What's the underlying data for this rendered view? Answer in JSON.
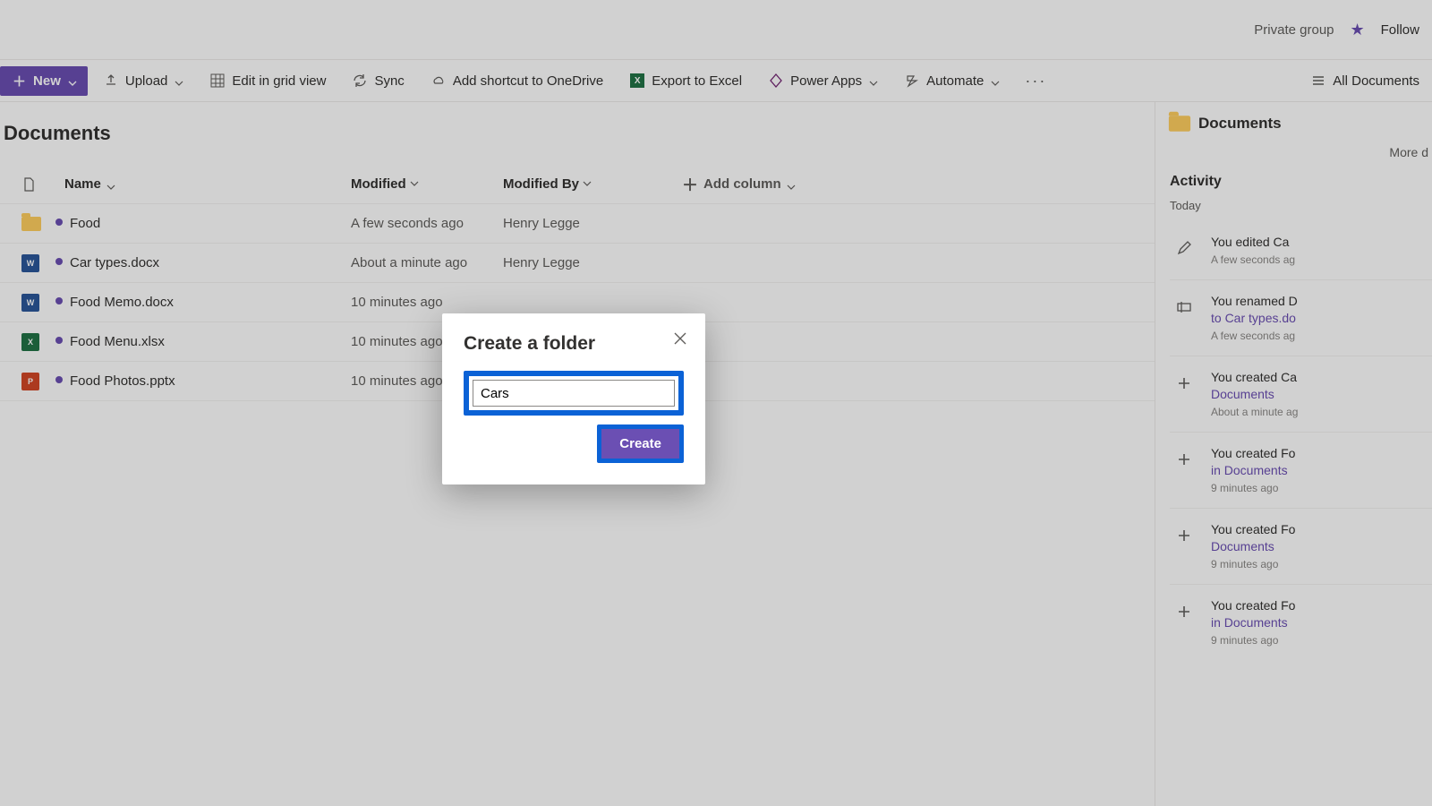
{
  "topbar": {
    "private": "Private group",
    "follow": "Follow"
  },
  "cmdbar": {
    "new": "New",
    "upload": "Upload",
    "editgrid": "Edit in grid view",
    "sync": "Sync",
    "shortcut": "Add shortcut to OneDrive",
    "export": "Export to Excel",
    "powerapps": "Power Apps",
    "automate": "Automate",
    "viewname": "All Documents"
  },
  "library": {
    "title": "Documents"
  },
  "columns": {
    "name": "Name",
    "modified": "Modified",
    "modifiedby": "Modified By",
    "addcol": "Add column"
  },
  "rows": [
    {
      "icon": "folder",
      "name": "Food",
      "modified": "A few seconds ago",
      "modifiedby": "Henry Legge"
    },
    {
      "icon": "word",
      "name": "Car types.docx",
      "modified": "About a minute ago",
      "modifiedby": "Henry Legge"
    },
    {
      "icon": "word",
      "name": "Food Memo.docx",
      "modified": "10 minutes ago",
      "modifiedby": ""
    },
    {
      "icon": "xls",
      "name": "Food Menu.xlsx",
      "modified": "10 minutes ago",
      "modifiedby": ""
    },
    {
      "icon": "ppt",
      "name": "Food Photos.pptx",
      "modified": "10 minutes ago",
      "modifiedby": ""
    }
  ],
  "panel": {
    "title": "Documents",
    "more": "More d",
    "activity": "Activity",
    "today": "Today",
    "items": [
      {
        "icon": "edit",
        "line1": "You edited Ca",
        "line2": "",
        "time": "A few seconds ag"
      },
      {
        "icon": "rename",
        "line1": "You renamed D",
        "line2": "to Car types.do",
        "time": "A few seconds ag"
      },
      {
        "icon": "create",
        "line1": "You created Ca",
        "line2": "Documents",
        "time": "About a minute ag"
      },
      {
        "icon": "create",
        "line1": "You created Fo",
        "line2": "in Documents",
        "time": "9 minutes ago"
      },
      {
        "icon": "create",
        "line1": "You created Fo",
        "line2": "Documents",
        "time": "9 minutes ago"
      },
      {
        "icon": "create",
        "line1": "You created Fo",
        "line2": "in Documents",
        "time": "9 minutes ago"
      }
    ]
  },
  "modal": {
    "title": "Create a folder",
    "input": "Cars",
    "create": "Create"
  }
}
